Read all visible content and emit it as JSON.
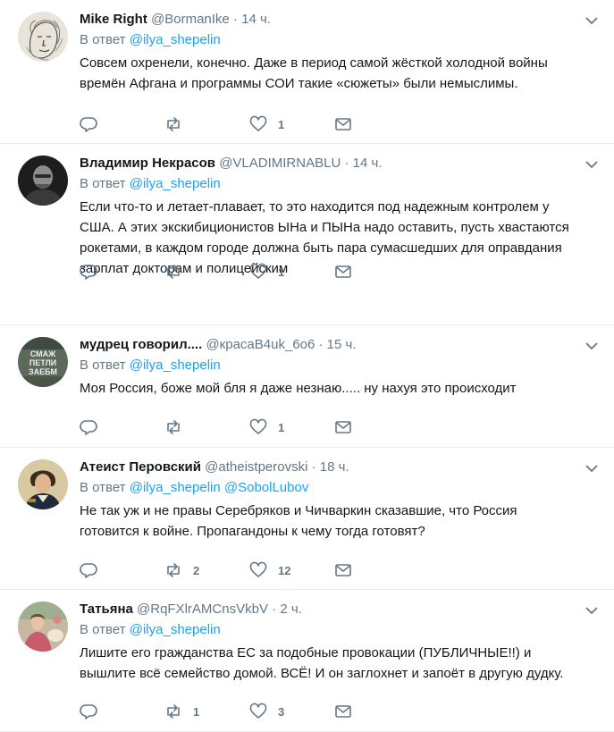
{
  "reply_prefix": "В ответ",
  "colors": {
    "link": "#1da1f2",
    "muted": "#657786",
    "text": "#14171a",
    "divider": "#e6ecf0"
  },
  "icons": {
    "reply": "reply-icon",
    "retweet": "retweet-icon",
    "like": "heart-icon",
    "dm": "envelope-icon",
    "menu": "chevron-down-icon"
  },
  "tweets": [
    {
      "name": "Mike Right",
      "handle": "@BormanIke",
      "dot": "·",
      "time": "14 ч.",
      "reply_mentions": [
        "@ilya_shepelin"
      ],
      "text": "Совсем охренели, конечно. Даже в период самой жёсткой холодной войны времён Афгана и программы СОИ такие «сюжеты» были немыслимы.",
      "replies": "",
      "retweets": "",
      "likes": "1"
    },
    {
      "name": "Владимир Некрасов",
      "handle": "@VLADIMIRNABLU",
      "dot": "·",
      "time": "14 ч.",
      "reply_mentions": [
        "@ilya_shepelin"
      ],
      "text": "Если что-то и летает-плавает, то это находится под надежным контролем у США. А этих экскибиционистов ЫНа и ПЫНа надо оставить, пусть хвастаются рокетами, в каждом городе должна быть пара сумасшедших для оправдания зарплат докторам и полицейским",
      "replies": "",
      "retweets": "",
      "likes": "1"
    },
    {
      "name": "мудрец говорил....",
      "handle": "@красаB4uk_6o6",
      "dot": "·",
      "time": "15 ч.",
      "reply_mentions": [
        "@ilya_shepelin"
      ],
      "text": "Моя Россия, боже мой бля я даже незнаю..... ну нахуя это происходит",
      "replies": "",
      "retweets": "",
      "likes": "1",
      "avatar_text": [
        "СМАЖ",
        "ПЕТЛИ",
        "ЗАЕБМ"
      ]
    },
    {
      "name": "Атеист Перовский",
      "handle": "@atheistperovski",
      "dot": "·",
      "time": "18 ч.",
      "reply_mentions": [
        "@ilya_shepelin",
        "@SobolLubov"
      ],
      "text": "Не так уж и не правы Серебряков и Чичваркин сказавшие, что Россия готовится к войне. Пропагандоны к чему тогда готовят?",
      "replies": "",
      "retweets": "2",
      "likes": "12"
    },
    {
      "name": "Татьяна",
      "handle": "@RqFXlrAMCnsVkbV",
      "dot": "·",
      "time": "2 ч.",
      "reply_mentions": [
        "@ilya_shepelin"
      ],
      "text": "Лишите его гражданства ЕС за подобные провокации (ПУБЛИЧНЫЕ!!) и вышлите всё семейство домой. ВСЁ! И он заглохнет и запоёт в другую дудку.",
      "replies": "",
      "retweets": "1",
      "likes": "3"
    }
  ]
}
